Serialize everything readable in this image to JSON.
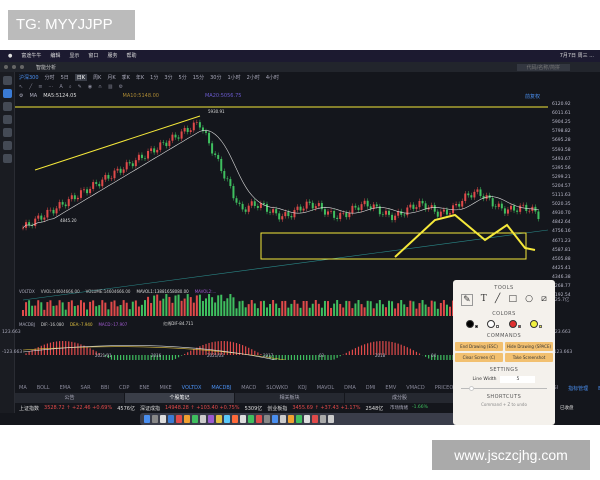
{
  "watermark_top": "TG: MYYJJPP",
  "watermark_bottom": "www.jsczcjhg.com",
  "menubar": {
    "items": [
      "",
      "富途牛牛",
      "编辑",
      "显示",
      "窗口",
      "服务",
      "帮助"
    ],
    "right": "7月7日 周三 ..."
  },
  "window": {
    "tab": "智能分析",
    "search_placeholder": "代码/名称/简拼"
  },
  "periods": {
    "symbol": "沪深300",
    "items": [
      "分时",
      "5日",
      "日K",
      "周K",
      "月K",
      "季K",
      "年K",
      "1分",
      "3分",
      "5分",
      "15分",
      "30分",
      "1小时",
      "2小时",
      "4小时"
    ],
    "active": "日K"
  },
  "ma_row": {
    "ma": "MA",
    "ma5": "MA5:5124.05",
    "ma10": "MA10:5148.00",
    "ma20": "MA20:5056.75",
    "right": "前复权"
  },
  "price_axis": [
    "6120.92",
    "6011.61",
    "5904.25",
    "5798.82",
    "5695.28",
    "5593.58",
    "5493.67",
    "5395.56",
    "5299.21",
    "5204.57",
    "5111.63",
    "5020.35",
    "4930.70",
    "4842.64",
    "4756.16",
    "4671.23",
    "4587.81",
    "4505.88",
    "4425.41",
    "4346.38",
    "4268.77",
    "4192.54"
  ],
  "chart_labels": {
    "high": "5930.91",
    "low": "4845.20"
  },
  "volume": {
    "label": "VOLTDX",
    "vvol": "VVOL:14604666.00",
    "volume": "VOLUME:14604666.00",
    "mavol": "MAVOL1:13881658080.00",
    "mavol2": "MAVOL2:...",
    "axis": "225.7亿"
  },
  "macd": {
    "label": "MACDBJ",
    "dif": "DIF:-16.080",
    "dea": "DEA:-7.940",
    "macd": "MACD:-17.907",
    "note": "红线DIF-84.711",
    "axis_top": "123.663",
    "axis_bottom": "-123.663"
  },
  "dates": [
    "2021/01",
    "2016",
    "2021/03",
    "2017",
    "03",
    "2018",
    "04",
    "2019",
    "05"
  ],
  "indicators": [
    "MA",
    "BOLL",
    "EMA",
    "SAR",
    "BBI",
    "CDP",
    "ENE",
    "MIKE",
    "VOLTDX",
    "MACDBJ",
    "MACD",
    "SLOWKD",
    "KDJ",
    "MAVOL",
    "DMA",
    "DMI",
    "EMV",
    "VMACD",
    "PRICEOSC",
    "ODI",
    "CCI",
    "MTM",
    "OSC",
    "RSI"
  ],
  "indicators_right": [
    "指标管理",
    "时间"
  ],
  "bottom_tabs": [
    "公告",
    "个股笔记",
    "相关板块",
    "成分股"
  ],
  "bottom_tab_active": "个股笔记",
  "ticker": [
    {
      "name": "上证指数",
      "val": "3528.72 ↑ +22.46 +0.69%",
      "amt": "4576亿"
    },
    {
      "name": "深证成指",
      "val": "14948.28 ↑ +103.40 +0.75%",
      "amt": "5309亿"
    },
    {
      "name": "创业板指",
      "val": "3455.69 ↑ +37.43 +1.17%",
      "amt": "2548亿"
    }
  ],
  "ticker_right": {
    "label": "市场情绪",
    "value": "-1.66%",
    "status": "已收盘"
  },
  "panel": {
    "tools": "TOOLS",
    "colors": "COLORS",
    "commands": "COMMANDS",
    "cmds": [
      "End Drawing (ESC)",
      "Hide Drawing (SPACE)",
      "Clear Screen (C)",
      "Take Screenshot"
    ],
    "settings": "SETTINGS",
    "line_width_label": "Line Width",
    "line_width": "5",
    "shortcuts": "SHORTCUTS",
    "shortcut_hint": "Command + Z to undo",
    "palette": [
      "#000000",
      "#ffffff",
      "#e03030",
      "#f0f040"
    ]
  },
  "colors": {
    "up": "#e04a4a",
    "down": "#3fbf5f",
    "draw": "#f5e83a",
    "bg": "#14161c"
  }
}
